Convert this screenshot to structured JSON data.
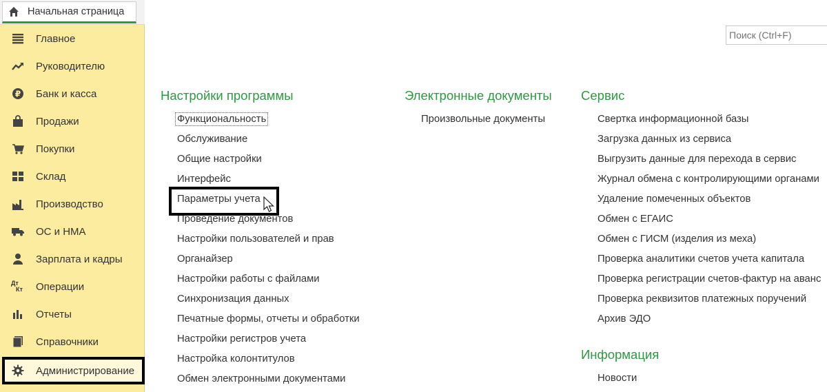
{
  "tab": {
    "label": "Начальная страница",
    "icon": "home-icon"
  },
  "search": {
    "placeholder": "Поиск (Ctrl+F)"
  },
  "colors": {
    "sidebar_bg": "#fbeca0",
    "section_title": "#2a9a3f",
    "tab_underline": "#2f9a3c"
  },
  "sidebar": {
    "items": [
      {
        "label": "Главное",
        "icon": "menu-lines-icon"
      },
      {
        "label": "Руководителю",
        "icon": "trend-up-icon"
      },
      {
        "label": "Банк и касса",
        "icon": "ruble-coin-icon"
      },
      {
        "label": "Продажи",
        "icon": "shopping-bag-icon"
      },
      {
        "label": "Покупки",
        "icon": "cart-icon"
      },
      {
        "label": "Склад",
        "icon": "warehouse-grid-icon"
      },
      {
        "label": "Производство",
        "icon": "factory-icon"
      },
      {
        "label": "ОС и НМА",
        "icon": "truck-icon"
      },
      {
        "label": "Зарплата и кадры",
        "icon": "person-icon"
      },
      {
        "label": "Операции",
        "icon": "dt-kt-icon",
        "icon_text_top": "Дт",
        "icon_text_bottom": "Кт"
      },
      {
        "label": "Отчеты",
        "icon": "bar-chart-icon"
      },
      {
        "label": "Справочники",
        "icon": "books-icon"
      },
      {
        "label": "Администрирование",
        "icon": "gear-icon"
      }
    ]
  },
  "columns": {
    "settings": {
      "title": "Настройки программы",
      "links": [
        "Функциональность",
        "Обслуживание",
        "Общие настройки",
        "Интерфейс",
        "Параметры учета",
        "Проведение документов",
        "Настройки пользователей и прав",
        "Органайзер",
        "Настройки работы с файлами",
        "Синхронизация данных",
        "Печатные формы, отчеты и обработки",
        "Настройки регистров учета",
        "Настройка колонтитулов",
        "Обмен электронными документами"
      ]
    },
    "edocs": {
      "title": "Электронные документы",
      "links": [
        "Произвольные документы"
      ]
    },
    "service": {
      "title": "Сервис",
      "links": [
        "Свертка информационной базы",
        "Загрузка данных из сервиса",
        "Выгрузить данные для перехода в сервис",
        "Журнал обмена с контролирующими органами",
        "Удаление помеченных объектов",
        "Обмен с ЕГАИС",
        "Обмен с ГИСМ (изделия из меха)",
        "Проверка аналитики счетов учета капитала",
        "Проверка регистрации счетов-фактур на аванс",
        "Проверка реквизитов платежных поручений",
        "Архив ЭДО"
      ]
    },
    "info": {
      "title": "Информация",
      "links": [
        "Новости"
      ]
    }
  }
}
